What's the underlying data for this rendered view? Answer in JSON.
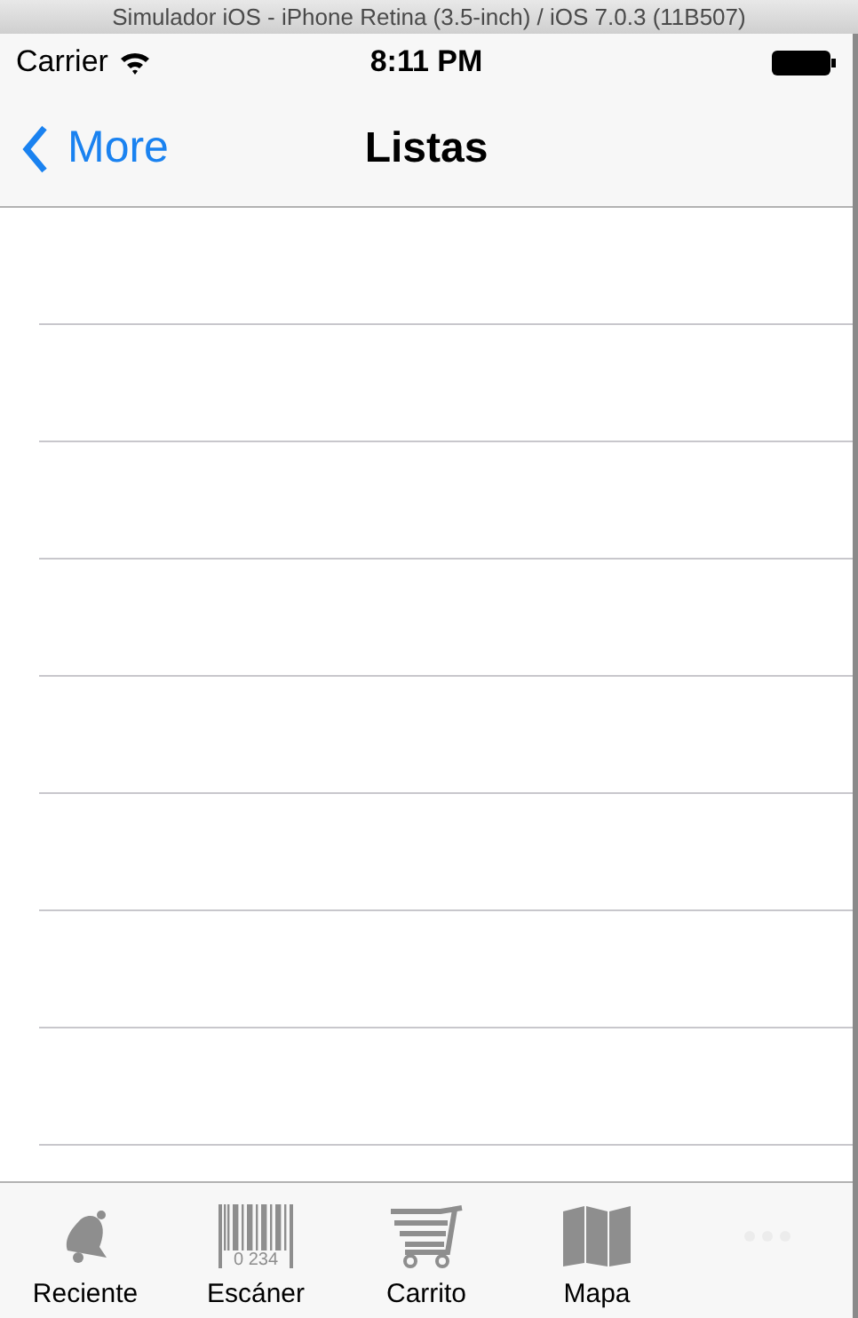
{
  "window": {
    "title": "Simulador iOS - iPhone Retina (3.5-inch) / iOS 7.0.3 (11B507)"
  },
  "status_bar": {
    "carrier": "Carrier",
    "time": "8:11 PM"
  },
  "nav_bar": {
    "back": "More",
    "title": "Listas"
  },
  "tab_bar": [
    {
      "kind": "bell",
      "label": "Reciente"
    },
    {
      "kind": "barcode",
      "label": "Escáner",
      "icon_text": "0 234"
    },
    {
      "kind": "cart",
      "label": "Carrito"
    },
    {
      "kind": "map",
      "label": "Mapa"
    },
    {
      "kind": "more"
    }
  ]
}
